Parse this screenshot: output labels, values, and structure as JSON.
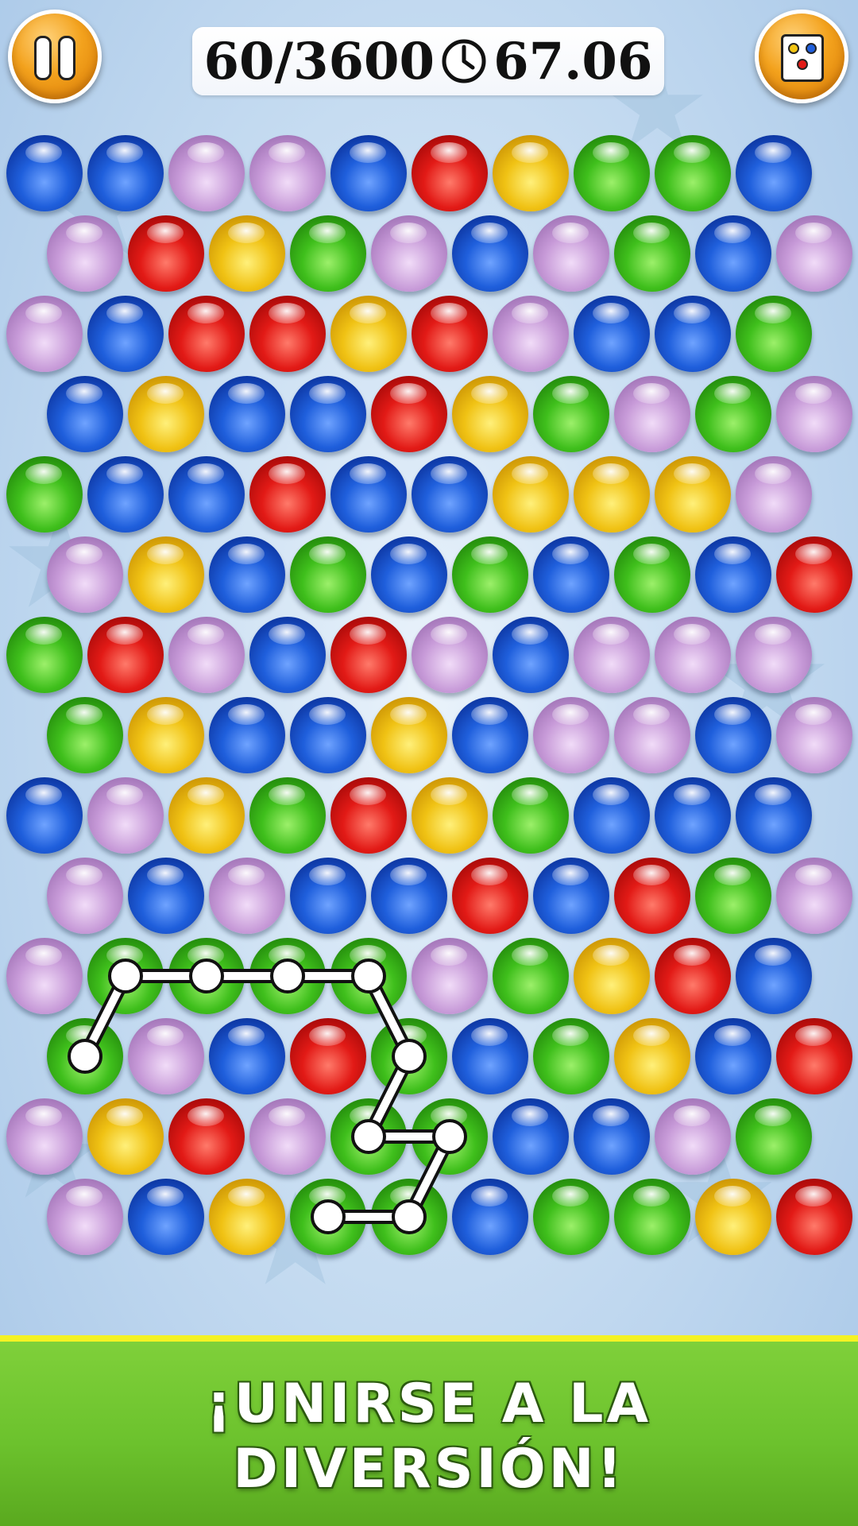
{
  "hud": {
    "score_text": "60/3600",
    "timer_text": "67.06",
    "pause_icon": "pause-icon",
    "colors_icon": "color-cards-icon",
    "clock_icon": "clock-icon",
    "accent_color": "#f3a21d"
  },
  "board": {
    "rows": [
      [
        "blue",
        "blue",
        "purple",
        "purple",
        "blue",
        "red",
        "yellow",
        "green",
        "green",
        "blue"
      ],
      [
        "purple",
        "red",
        "yellow",
        "green",
        "purple",
        "blue",
        "purple",
        "green",
        "blue",
        "purple"
      ],
      [
        "purple",
        "blue",
        "red",
        "red",
        "yellow",
        "red",
        "purple",
        "blue",
        "blue",
        "green"
      ],
      [
        "blue",
        "yellow",
        "blue",
        "blue",
        "red",
        "yellow",
        "green",
        "purple",
        "green",
        "purple"
      ],
      [
        "green",
        "blue",
        "blue",
        "red",
        "blue",
        "blue",
        "yellow",
        "yellow",
        "yellow",
        "purple"
      ],
      [
        "purple",
        "yellow",
        "blue",
        "green",
        "blue",
        "green",
        "blue",
        "green",
        "blue",
        "red"
      ],
      [
        "green",
        "red",
        "purple",
        "blue",
        "red",
        "purple",
        "blue",
        "purple",
        "purple",
        "purple"
      ],
      [
        "green",
        "yellow",
        "blue",
        "blue",
        "yellow",
        "blue",
        "purple",
        "purple",
        "blue",
        "purple"
      ],
      [
        "blue",
        "purple",
        "yellow",
        "green",
        "red",
        "yellow",
        "green",
        "blue",
        "blue",
        "blue"
      ],
      [
        "purple",
        "blue",
        "purple",
        "blue",
        "blue",
        "red",
        "blue",
        "red",
        "green",
        "purple"
      ],
      [
        "purple",
        "green",
        "green",
        "green",
        "green",
        "purple",
        "green",
        "yellow",
        "red",
        "blue"
      ],
      [
        "green",
        "purple",
        "blue",
        "red",
        "green",
        "blue",
        "green",
        "yellow",
        "blue",
        "red"
      ],
      [
        "purple",
        "yellow",
        "red",
        "purple",
        "green",
        "green",
        "blue",
        "blue",
        "purple",
        "green"
      ],
      [
        "purple",
        "blue",
        "yellow",
        "green",
        "green",
        "blue",
        "green",
        "green",
        "yellow",
        "red"
      ]
    ],
    "selected_path": [
      [
        11,
        0
      ],
      [
        10,
        1
      ],
      [
        10,
        2
      ],
      [
        10,
        3
      ],
      [
        10,
        4
      ],
      [
        11,
        4
      ],
      [
        12,
        4
      ],
      [
        12,
        5
      ],
      [
        13,
        4
      ],
      [
        13,
        3
      ]
    ],
    "path_color": "green"
  },
  "banner": {
    "line1": "¡UNIRSE A LA",
    "line2": "DIVERSIÓN!"
  }
}
